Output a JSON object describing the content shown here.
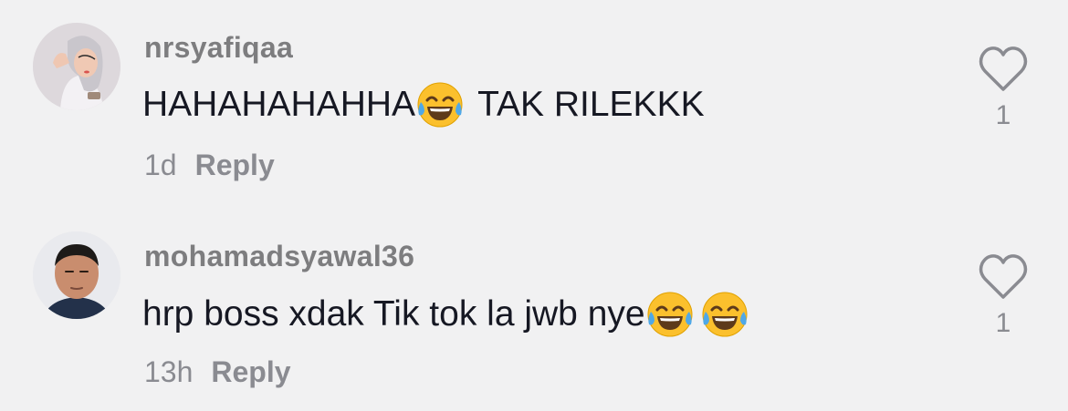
{
  "comments": [
    {
      "username": "nrsyafiqaa",
      "text_parts": [
        "HAHAHAHAHHA",
        "TAK RILEKKK"
      ],
      "emoji": "face-with-tears-of-joy-icon",
      "time": "1d",
      "reply_label": "Reply",
      "like_count": "1"
    },
    {
      "username": "mohamadsyawal36",
      "text_parts": [
        "hrp boss xdak Tik tok la jwb nye"
      ],
      "emoji": "face-with-tears-of-joy-icon",
      "time": "13h",
      "reply_label": "Reply",
      "like_count": "1"
    }
  ]
}
